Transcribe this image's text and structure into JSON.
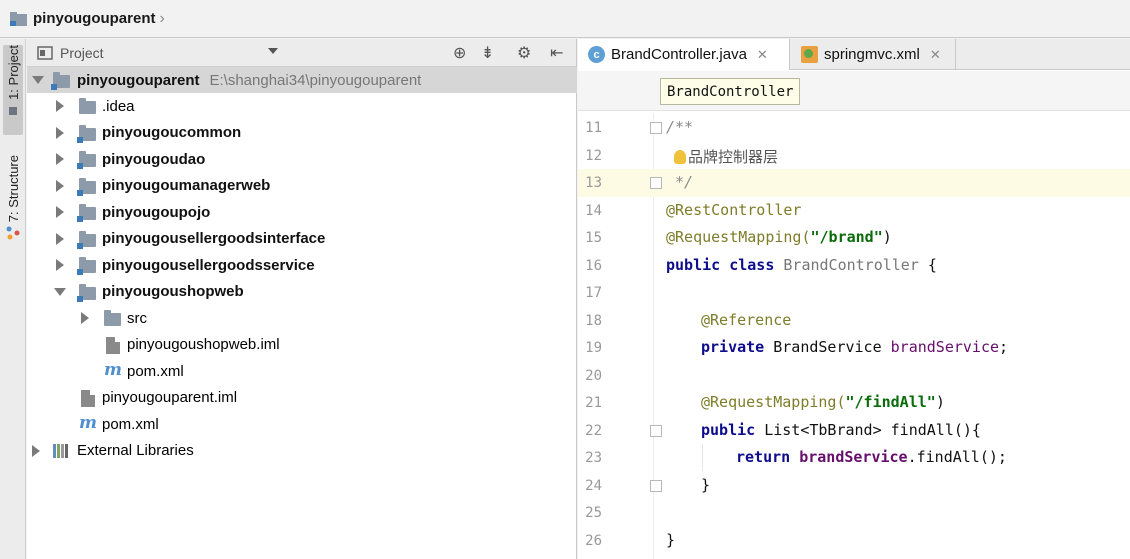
{
  "navbar": {
    "title": "pinyougouparent"
  },
  "left_strip": {
    "project_tab": "1: Project",
    "structure_tab": "7: Structure"
  },
  "project_panel": {
    "header_label": "Project",
    "tree": [
      {
        "label": "pinyougouparent",
        "path": "E:\\shanghai34\\pinyougouparent"
      },
      {
        "label": ".idea"
      },
      {
        "label": "pinyougoucommon"
      },
      {
        "label": "pinyougoudao"
      },
      {
        "label": "pinyougoumanagerweb"
      },
      {
        "label": "pinyougoupojo"
      },
      {
        "label": "pinyougousellergoodsinterface"
      },
      {
        "label": "pinyougousellergoodsservice"
      },
      {
        "label": "pinyougoushopweb"
      },
      {
        "label": "src"
      },
      {
        "label": "pinyougoushopweb.iml"
      },
      {
        "label": "pom.xml"
      },
      {
        "label": "pinyougouparent.iml"
      },
      {
        "label": "pom.xml"
      },
      {
        "label": "External Libraries"
      }
    ]
  },
  "editor": {
    "tabs": [
      {
        "label": "BrandController.java"
      },
      {
        "label": "springmvc.xml"
      }
    ],
    "breadcrumb": "BrandController",
    "line_numbers": [
      "11",
      "12",
      "13",
      "14",
      "15",
      "16",
      "17",
      "18",
      "19",
      "20",
      "21",
      "22",
      "23",
      "24",
      "25",
      "26"
    ],
    "code": {
      "l11": "/**",
      "l12_text": "品牌控制器层",
      "l13": " */",
      "l14": "@RestController",
      "l15_ann": "@RequestMapping(",
      "l15_str": "\"/brand\"",
      "l15_end": ")",
      "l16_kw": "public class",
      "l16_cls": "BrandController",
      "l16_end": "{",
      "l18": "@Reference",
      "l19_kw": "private",
      "l19_type": "BrandService",
      "l19_field": "brandService",
      "l19_end": ";",
      "l21_ann": "@RequestMapping(",
      "l21_str": "\"/findAll\"",
      "l21_end": ")",
      "l22_kw": "public",
      "l22_rest": "List<TbBrand> findAll(){",
      "l23_kw": "return",
      "l23_field": "brandService",
      "l23_rest": ".findAll();",
      "l24": "}",
      "l26": "}"
    }
  }
}
